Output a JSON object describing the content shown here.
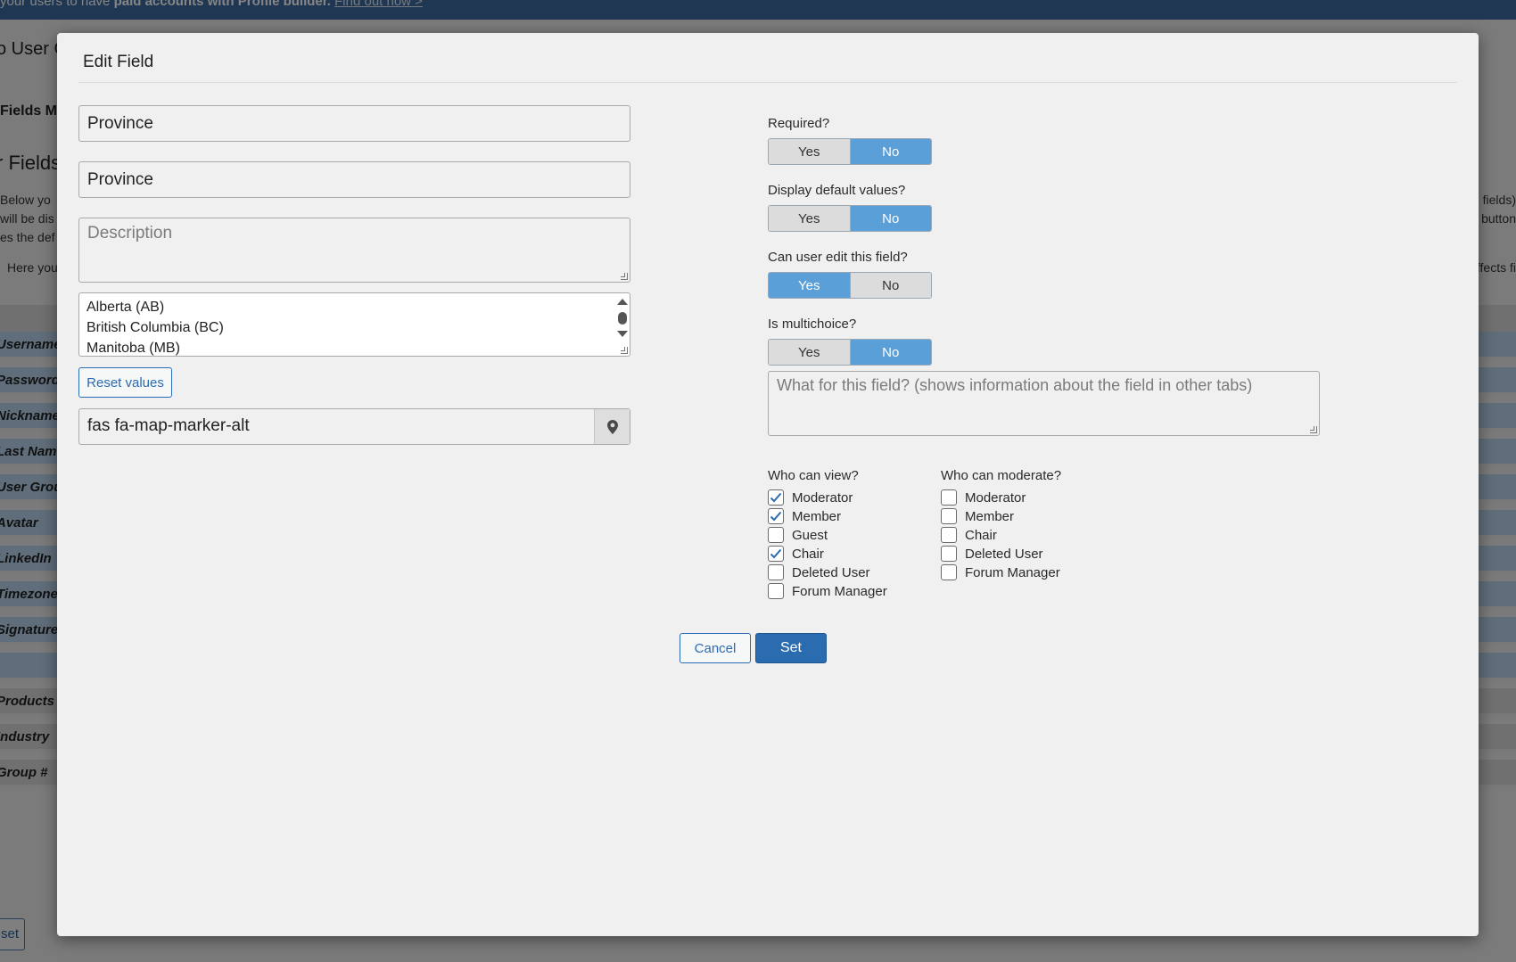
{
  "background": {
    "banner_prefix": "your users to have ",
    "banner_bold": "paid accounts with Profile builder.",
    "banner_link": "Find out now >",
    "page_title": "o User G",
    "tab_label": "Fields Ma",
    "section_heading": "r Fields",
    "para_lines": [
      "Below yo",
      "will be dis",
      "es the def",
      "Here you"
    ],
    "right_lines": [
      "fields)",
      "button",
      "ffects fi"
    ],
    "rows": [
      "Username",
      "Password",
      "Nickname",
      "Last Name",
      "User Group",
      "Avatar",
      "LinkedIn",
      "Timezone",
      "Signature",
      "",
      "Products &",
      "Industry",
      "Group #"
    ],
    "bottom_button": "set"
  },
  "modal": {
    "title": "Edit Field",
    "field_name": "Province",
    "field_label": "Province",
    "description_placeholder": "Description",
    "options": [
      "Alberta (AB)",
      "British Columbia (BC)",
      "Manitoba (MB)"
    ],
    "reset_button": "Reset values",
    "icon_value": "fas fa-map-marker-alt",
    "icon_addon": "map-marker-icon",
    "required": {
      "label": "Required?",
      "yes": "Yes",
      "no": "No",
      "selected": "No"
    },
    "display_default": {
      "label": "Display default values?",
      "yes": "Yes",
      "no": "No",
      "selected": "No"
    },
    "user_edit": {
      "label": "Can user edit this field?",
      "yes": "Yes",
      "no": "No",
      "selected": "Yes"
    },
    "multichoice": {
      "label": "Is multichoice?",
      "yes": "Yes",
      "no": "No",
      "selected": "No"
    },
    "info_placeholder": "What for this field? (shows information about the field in other tabs)",
    "who_can_view": {
      "label": "Who can view?",
      "items": [
        {
          "label": "Moderator",
          "checked": true
        },
        {
          "label": "Member",
          "checked": true
        },
        {
          "label": "Guest",
          "checked": false
        },
        {
          "label": "Chair",
          "checked": true
        },
        {
          "label": "Deleted User",
          "checked": false
        },
        {
          "label": "Forum Manager",
          "checked": false
        }
      ]
    },
    "who_can_moderate": {
      "label": "Who can moderate?",
      "items": [
        {
          "label": "Moderator",
          "checked": false
        },
        {
          "label": "Member",
          "checked": false
        },
        {
          "label": "Chair",
          "checked": false
        },
        {
          "label": "Deleted User",
          "checked": false
        },
        {
          "label": "Forum Manager",
          "checked": false
        }
      ]
    },
    "cancel_button": "Cancel",
    "set_button": "Set"
  },
  "colors": {
    "accent": "#5a9fd8",
    "primary_button": "#2b6cb0",
    "banner": "#3d6a9e"
  }
}
